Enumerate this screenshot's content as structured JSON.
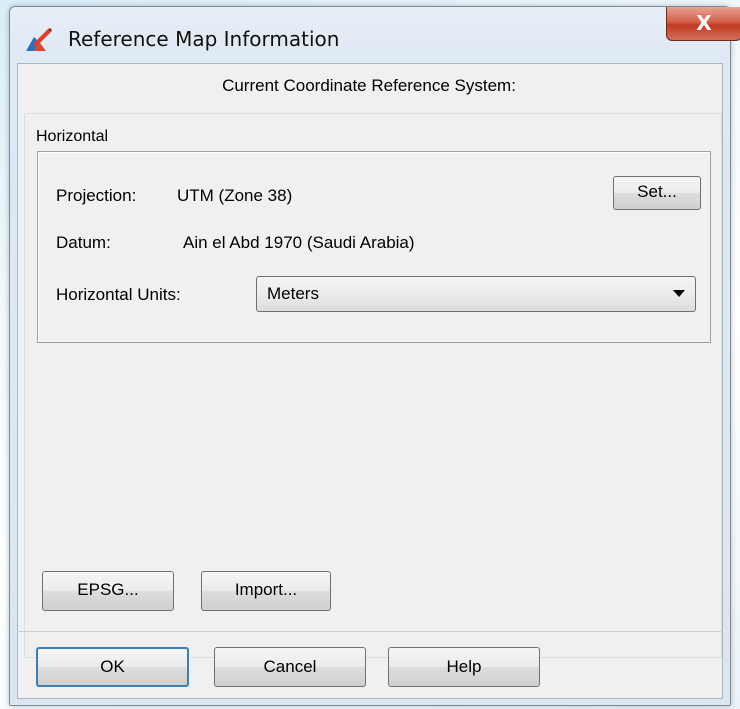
{
  "window": {
    "title": "Reference Map Information",
    "close_glyph": "X"
  },
  "header": {
    "section_title": "Current Coordinate Reference System:"
  },
  "horizontal": {
    "group_label": "Horizontal",
    "projection_label": "Projection:",
    "projection_value": "UTM (Zone 38)",
    "set_button": "Set...",
    "datum_label": "Datum:",
    "datum_value": "Ain el Abd 1970 (Saudi Arabia)",
    "units_label": "Horizontal Units:",
    "units_selected": "Meters"
  },
  "buttons": {
    "epsg": "EPSG...",
    "import": "Import...",
    "ok": "OK",
    "cancel": "Cancel",
    "help": "Help"
  },
  "icons": {
    "app": "map-pencil-icon",
    "close": "close-icon",
    "dropdown": "chevron-down-icon"
  },
  "colors": {
    "close_button": "#c9442b",
    "default_button_border": "#3c7fb1",
    "dialog_background": "#f0f0f0"
  }
}
